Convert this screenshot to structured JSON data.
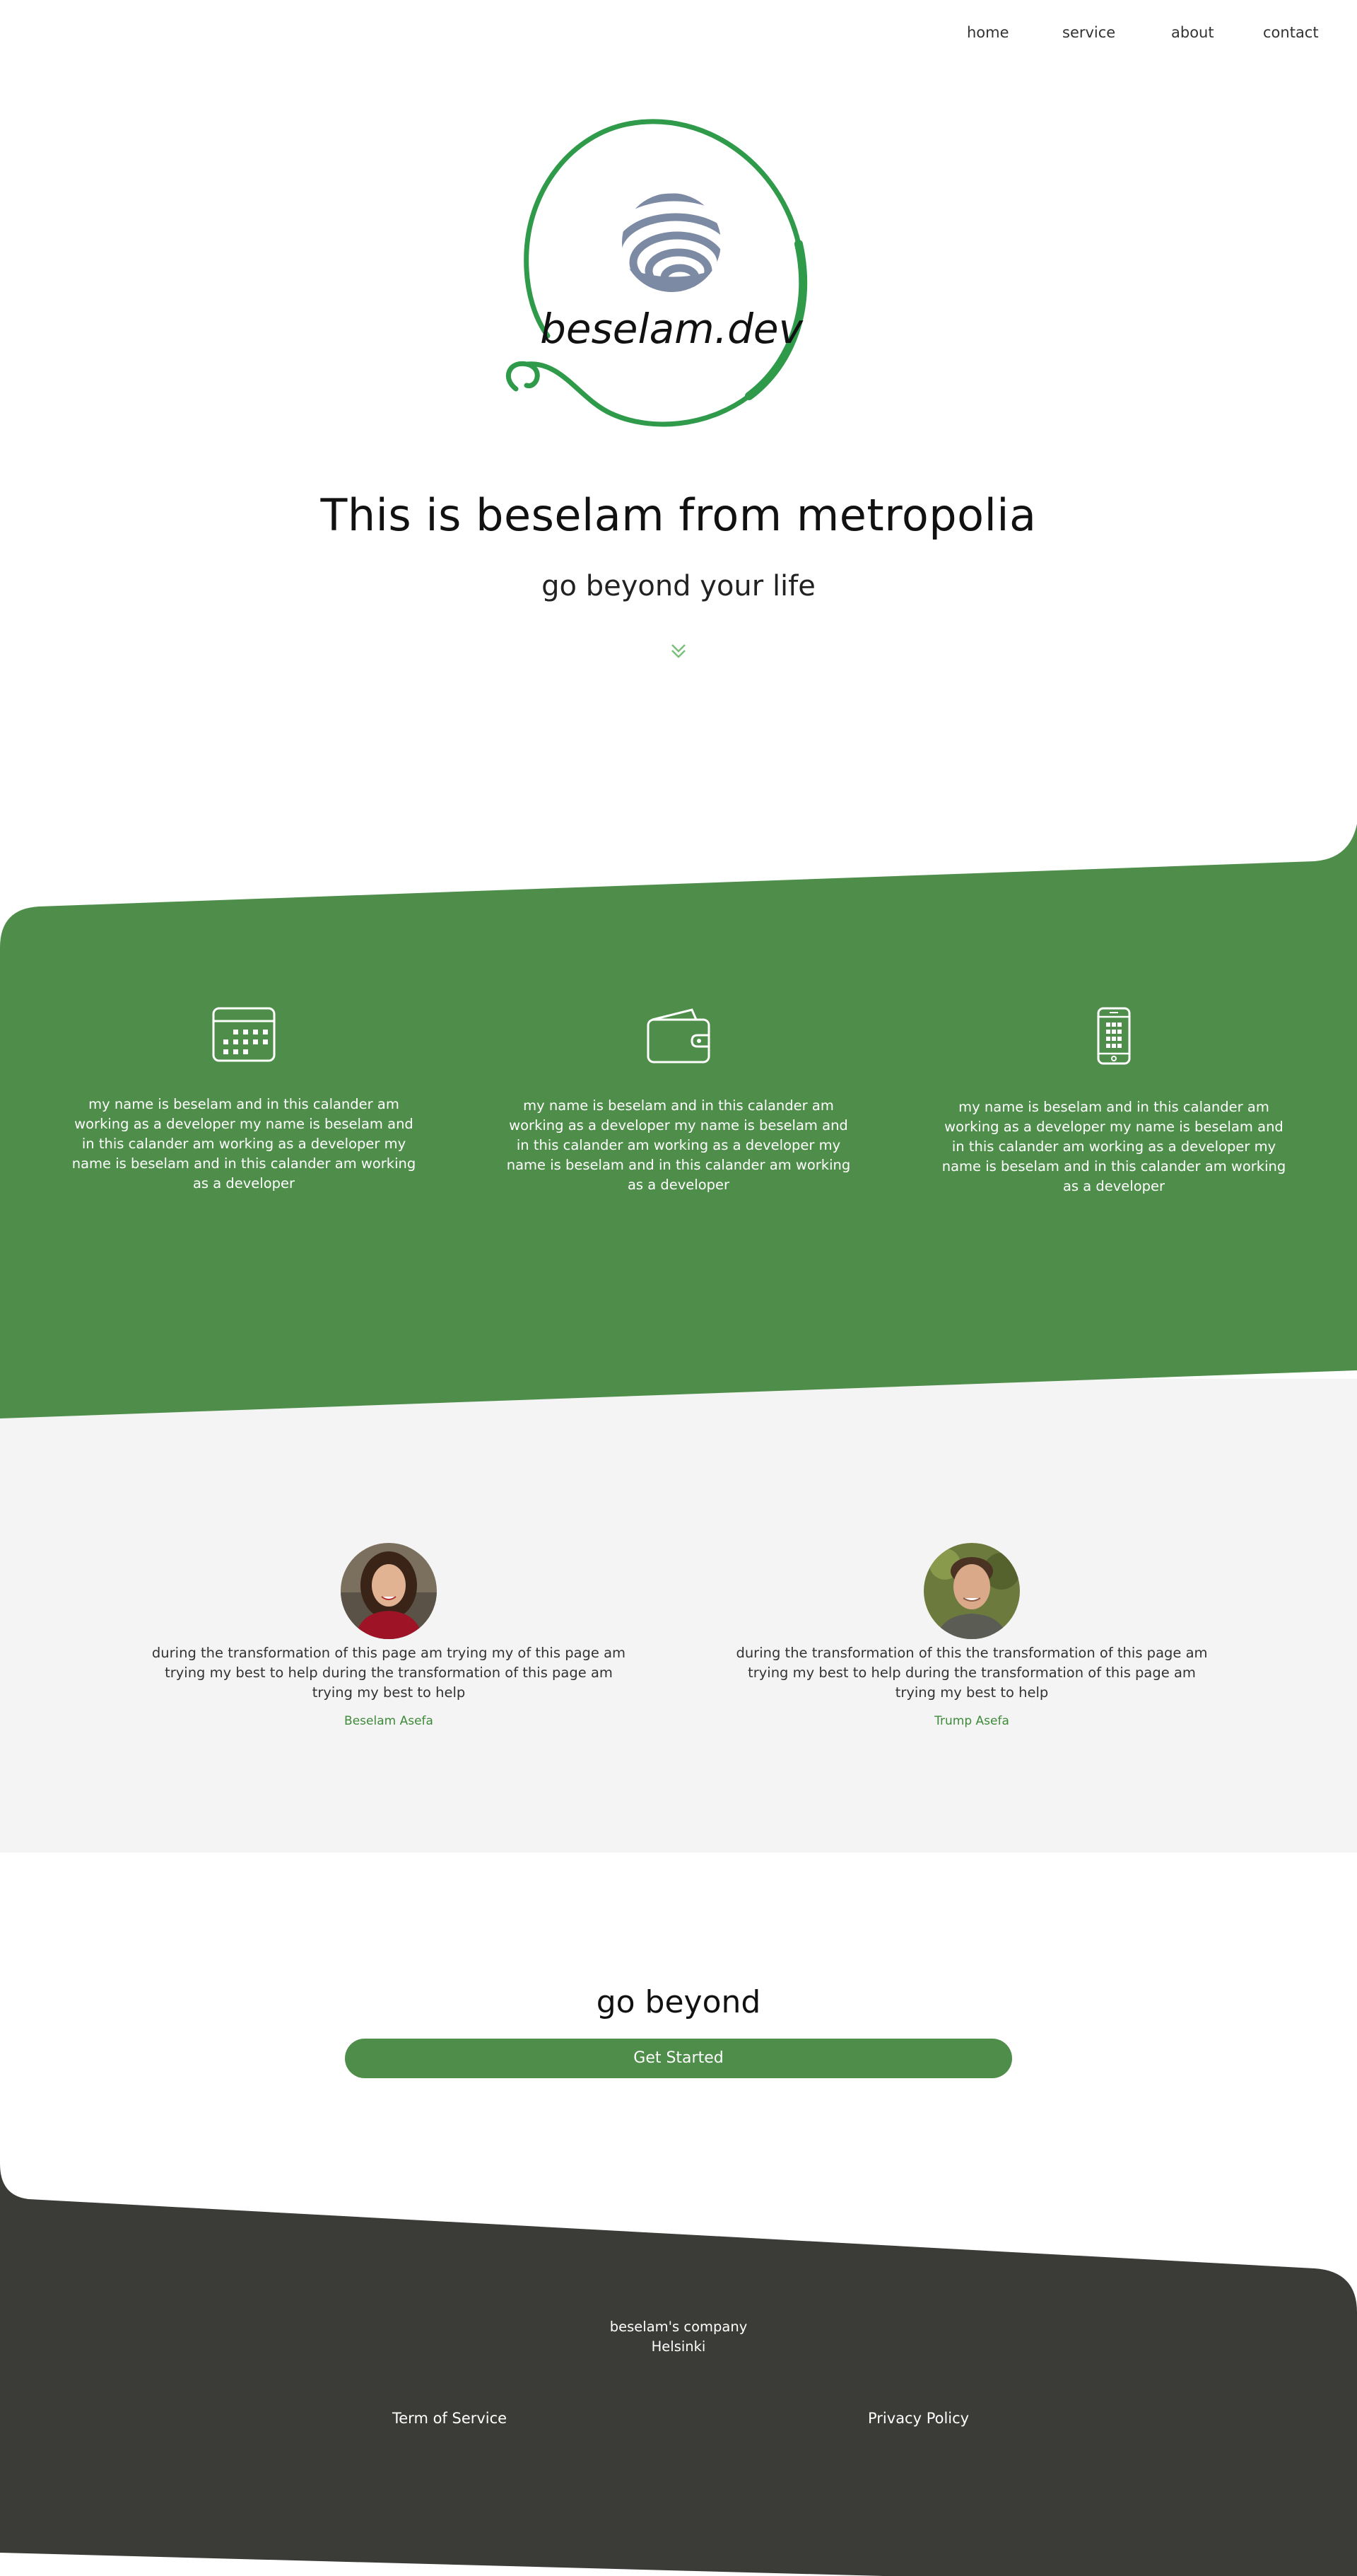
{
  "nav": {
    "items": [
      {
        "label": "home"
      },
      {
        "label": "service"
      },
      {
        "label": "about"
      },
      {
        "label": "contact"
      }
    ]
  },
  "logo": {
    "text": "beselam.dev",
    "accent_color": "#2e9a4a",
    "globe_color": "#7d8aa3"
  },
  "hero": {
    "title": "This is beselam from metropolia",
    "subtitle": "go beyond your life",
    "scroll_icon": "double-chevron-down-icon"
  },
  "features": {
    "background_color": "#4e8e4a",
    "items": [
      {
        "icon": "calendar-icon",
        "text": "my name is beselam and in this calander am working as a developer my name is beselam and in this calander am working as a developer my name is beselam and in this calander am working as a developer"
      },
      {
        "icon": "wallet-icon",
        "text": "my name is beselam and in this calander am working as a developer my name is beselam and in this calander am working as a developer my name is beselam and in this calander am working as a developer"
      },
      {
        "icon": "mobile-phone-icon",
        "text": "my name is beselam and in this calander am working as a developer my name is beselam and in this calander am working as a developer my name is beselam and in this calander am working as a developer"
      }
    ]
  },
  "testimonials": [
    {
      "text": "during the transformation of this page am trying my of this page am trying my best to help during the transformation of this page am trying my best to help",
      "name": "Beselam Asefa"
    },
    {
      "text": "during the transformation of this the transformation of this page am trying my best to help during the transformation of this page am trying my best to help",
      "name": "Trump Asefa"
    }
  ],
  "cta": {
    "title": "go beyond",
    "button_label": "Get Started"
  },
  "footer": {
    "background_color": "#3b3b38",
    "company": "beselam's company",
    "city": "Helsinki",
    "terms_label": "Term of Service",
    "privacy_label": "Privacy Policy"
  }
}
